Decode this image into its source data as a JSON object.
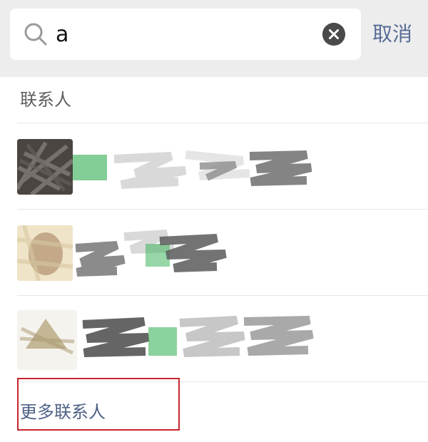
{
  "search": {
    "value": "a",
    "cancel_label": "取消"
  },
  "section_title": "联系人",
  "contacts": [
    {
      "name_redacted": true
    },
    {
      "name_redacted": true
    },
    {
      "name_redacted": true
    }
  ],
  "more_contacts_label": "更多联系人",
  "colors": {
    "search_bar_bg": "#ededed",
    "link_blue": "#576b95",
    "highlight_border": "#c7252b"
  }
}
